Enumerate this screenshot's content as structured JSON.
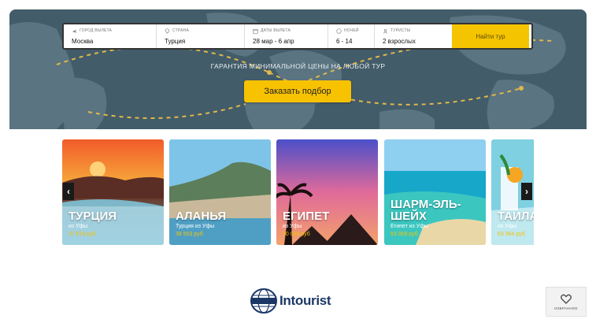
{
  "search": {
    "fields": [
      {
        "label": "ГОРОД ВЫЛЕТА",
        "value": "Москва",
        "icon": "plane-icon"
      },
      {
        "label": "СТРАНА",
        "value": "Турция",
        "icon": "location-pin-icon"
      },
      {
        "label": "ДАТЫ ВЫЛЕТА",
        "value": "28 мар - 6 апр",
        "icon": "calendar-icon"
      },
      {
        "label": "НОЧЕЙ",
        "value": "6 - 14",
        "icon": "moon-icon"
      },
      {
        "label": "ТУРИСТЫ",
        "value": "2 взрослых",
        "icon": "person-icon"
      }
    ],
    "submit_label": "Найти тур"
  },
  "hero": {
    "guarantee": "ГАРАНТИЯ МИНИМАЛЬНОЙ ЦЕНЫ НА ЛЮБОЙ ТУР",
    "cta_label": "Заказать подбор"
  },
  "destinations": [
    {
      "name": "ТУРЦИЯ",
      "from": "из Уфы",
      "price": "37 616 руб"
    },
    {
      "name": "АЛАНЬЯ",
      "from": "Турция из Уфы",
      "price": "38 553 руб"
    },
    {
      "name": "ЕГИПЕТ",
      "from": "из Уфы",
      "price": "50 038 руб"
    },
    {
      "name": "ШАРМ-ЭЛЬ-ШЕЙХ",
      "from": "Египет из Уфы",
      "price": "53 009 руб"
    },
    {
      "name": "ТАИЛАНД",
      "from": "из Уфы",
      "price": "63 364 руб"
    }
  ],
  "carousel": {
    "prev_icon": "‹",
    "next_icon": "›"
  },
  "footer": {
    "logo_text": "Intourist",
    "favorites_label": "ИЗБРАННОЕ"
  },
  "colors": {
    "accent": "#f7c200",
    "hero_bg": "#3e5866",
    "brand": "#1b3766"
  }
}
